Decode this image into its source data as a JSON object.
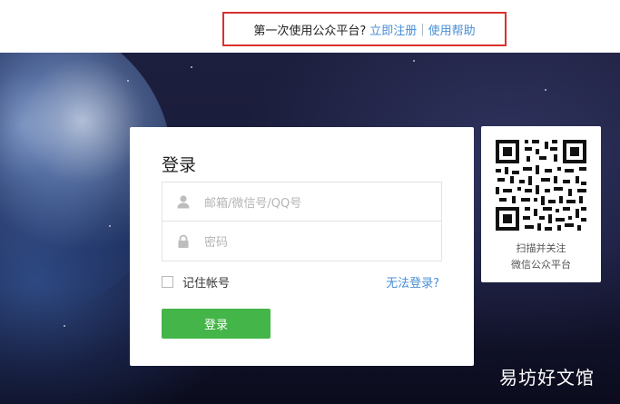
{
  "topbar": {
    "prompt": "第一次使用公众平台?",
    "register_link": "立即注册",
    "separator": "|",
    "help_link": "使用帮助",
    "highlight_color": "#d9322d"
  },
  "login": {
    "title": "登录",
    "username_placeholder": "邮箱/微信号/QQ号",
    "password_placeholder": "密码",
    "remember_label": "记住帐号",
    "cant_login_link": "无法登录?",
    "submit_label": "登录",
    "button_color": "#44b549",
    "link_color": "#4a8fd6"
  },
  "qr": {
    "line1": "扫描并关注",
    "line2": "微信公众平台"
  },
  "watermark": "易坊好文馆"
}
